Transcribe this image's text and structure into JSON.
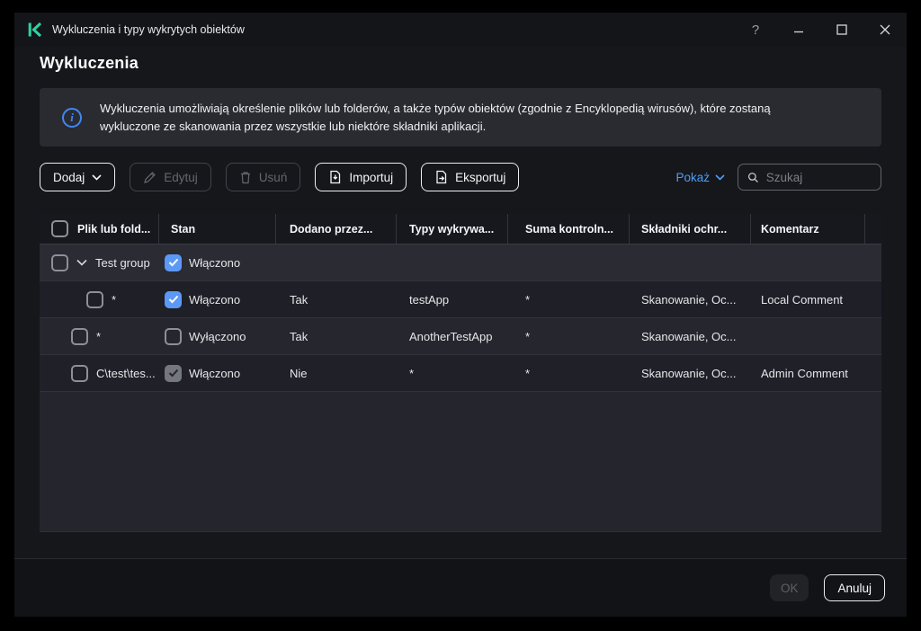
{
  "window": {
    "title": "Wykluczenia i typy wykrytych obiektów",
    "help_glyph": "?"
  },
  "page": {
    "title": "Wykluczenia"
  },
  "info": {
    "line1": "Wykluczenia umożliwiają określenie plików lub folderów, a także typów obiektów (zgodnie z Encyklopedią wirusów), które zostaną",
    "line2": "wykluczone ze skanowania przez wszystkie lub niektóre składniki aplikacji.",
    "icon_glyph": "i"
  },
  "toolbar": {
    "add_label": "Dodaj",
    "edit_label": "Edytuj",
    "edit_enabled": false,
    "delete_label": "Usuń",
    "delete_enabled": false,
    "import_label": "Importuj",
    "export_label": "Eksportuj",
    "show_label": "Pokaż",
    "search_placeholder": "Szukaj",
    "search_value": ""
  },
  "table": {
    "columns": {
      "file": "Plik lub fold...",
      "state": "Stan",
      "added_by": "Dodano przez...",
      "detect_types": "Typy wykrywa...",
      "checksum": "Suma kontroln...",
      "components": "Składniki ochr...",
      "comment": "Komentarz"
    },
    "select_all_checked": false,
    "group": {
      "name": "Test group",
      "expanded": true,
      "selected": false,
      "state_label": "Włączono",
      "state_checked": true,
      "state_enabled": true
    },
    "rows": [
      {
        "file": "*",
        "selected": false,
        "state_label": "Włączono",
        "state_checked": true,
        "state_enabled": true,
        "added_by": "Tak",
        "detect_types": "testApp",
        "checksum": "*",
        "components": "Skanowanie, Oc...",
        "comment": "Local Comment"
      },
      {
        "file": "*",
        "selected": false,
        "state_label": "Wyłączono",
        "state_checked": false,
        "state_enabled": true,
        "added_by": "Tak",
        "detect_types": "AnotherTestApp",
        "checksum": "*",
        "components": "Skanowanie, Oc...",
        "comment": ""
      },
      {
        "file": "C\\test\\tes...",
        "selected": false,
        "state_label": "Włączono",
        "state_checked": true,
        "state_enabled": false,
        "added_by": "Nie",
        "detect_types": "*",
        "checksum": "*",
        "components": "Skanowanie, Oc...",
        "comment": "Admin Comment"
      }
    ]
  },
  "footer": {
    "ok_label": "OK",
    "ok_enabled": false,
    "cancel_label": "Anuluj"
  },
  "colors": {
    "accent_blue": "#4c9ef8",
    "checkbox_checked": "#5b99f5",
    "checkbox_checked_disabled": "#75777e",
    "logo_teal": "#2bd4a4",
    "info_icon_blue": "#4186f5",
    "window_bg": "#16171b",
    "info_box_bg": "#2a2b31"
  }
}
